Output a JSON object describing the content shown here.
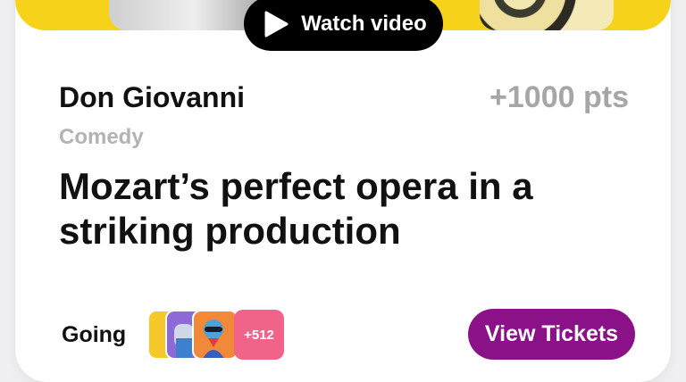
{
  "hero": {
    "watch_label": "Watch video",
    "accent_color": "#f6d21a"
  },
  "event": {
    "title": "Don Giovanni",
    "points": "+1000 pts",
    "genre": "Comedy",
    "headline": "Mozart’s perfect opera in a striking production"
  },
  "attendance": {
    "label": "Going",
    "more_count": "+512",
    "avatars": [
      "avatar-yellow",
      "avatar-purple",
      "avatar-orange"
    ]
  },
  "actions": {
    "tickets_label": "View Tickets",
    "tickets_color": "#8b1189"
  }
}
